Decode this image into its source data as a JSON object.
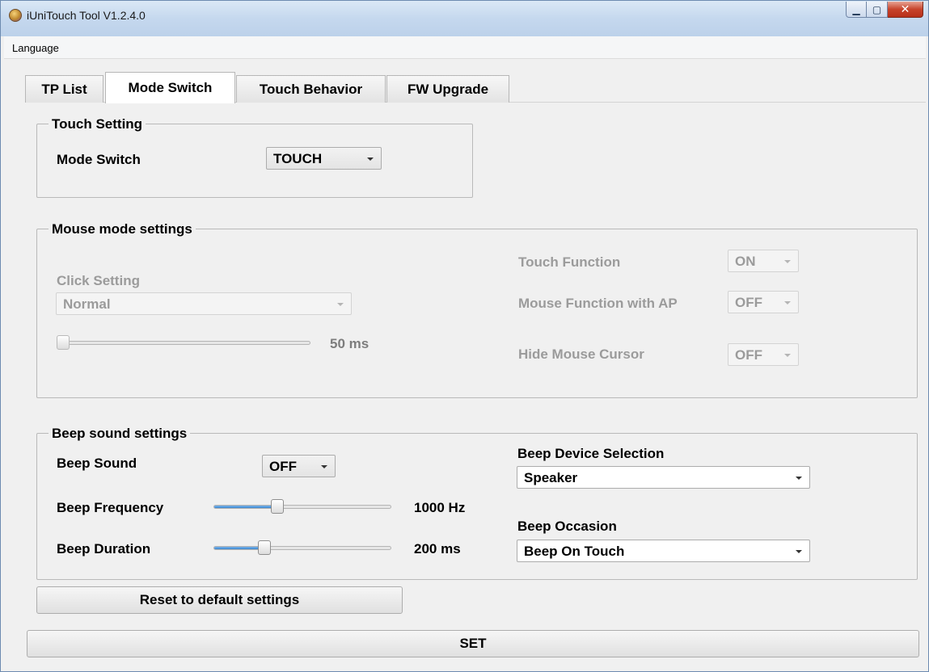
{
  "window": {
    "title": "iUniTouch Tool V1.2.4.0"
  },
  "menu": {
    "language": "Language"
  },
  "tabs": [
    {
      "label": "TP List"
    },
    {
      "label": "Mode Switch"
    },
    {
      "label": "Touch Behavior"
    },
    {
      "label": "FW Upgrade"
    }
  ],
  "touch_setting": {
    "title": "Touch Setting",
    "mode_switch_label": "Mode Switch",
    "mode_switch_value": "TOUCH"
  },
  "mouse_mode": {
    "title": "Mouse mode settings",
    "click_setting_label": "Click Setting",
    "click_setting_value": "Normal",
    "slider_value_text": "50 ms",
    "slider_fraction": 0.0,
    "touch_function_label": "Touch Function",
    "touch_function_value": "ON",
    "mouse_function_ap_label": "Mouse Function with AP",
    "mouse_function_ap_value": "OFF",
    "hide_cursor_label": "Hide Mouse Cursor",
    "hide_cursor_value": "OFF"
  },
  "beep": {
    "title": "Beep sound settings",
    "sound_label": "Beep Sound",
    "sound_value": "OFF",
    "frequency_label": "Beep Frequency",
    "frequency_value_text": "1000 Hz",
    "frequency_fraction": 0.35,
    "duration_label": "Beep Duration",
    "duration_value_text": "200 ms",
    "duration_fraction": 0.27,
    "device_label": "Beep Device Selection",
    "device_value": "Speaker",
    "occasion_label": "Beep Occasion",
    "occasion_value": "Beep On Touch"
  },
  "buttons": {
    "reset": "Reset to default settings",
    "set": "SET"
  },
  "colors": {
    "accent_fill": "#3b86d0",
    "disabled_text": "#9b9b9b"
  }
}
